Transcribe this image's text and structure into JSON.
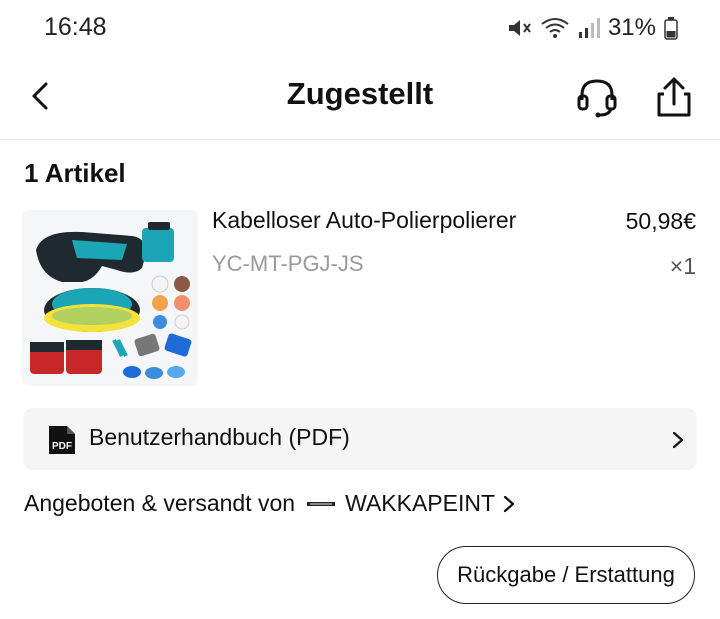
{
  "status_bar": {
    "time": "16:48",
    "battery_percent": "31%",
    "icons": [
      "mute-icon",
      "wifi-icon",
      "signal-icon",
      "battery-icon"
    ]
  },
  "header": {
    "title": "Zugestellt",
    "icons": [
      "back-arrow-icon",
      "headset-icon",
      "share-icon"
    ]
  },
  "order": {
    "items_count_label": "1 Artikel",
    "items": [
      {
        "name": "Kabelloser Auto-Polierpolierer",
        "sku": "YC-MT-PGJ-JS",
        "price": "50,98€",
        "quantity": "×1"
      }
    ]
  },
  "manual": {
    "label": "Benutzerhandbuch (PDF)",
    "icon_text": "PDF"
  },
  "seller": {
    "prefix": "Angeboten & versandt von",
    "name": "WAKKAPEINT"
  },
  "actions": {
    "return_label": "Rückgabe / Erstattung"
  },
  "colors": {
    "accent_teal": "#1aa6b5",
    "text": "#111111",
    "muted": "#9a9a9a",
    "row_bg": "#f5f5f5"
  }
}
